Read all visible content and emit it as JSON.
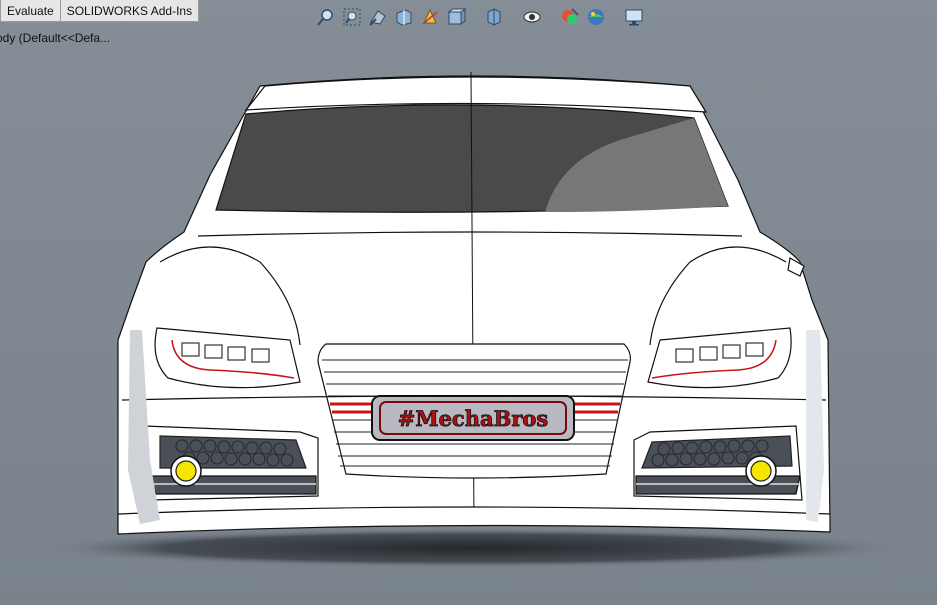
{
  "command_manager": {
    "tabs": [
      {
        "label": "Evaluate"
      },
      {
        "label": "SOLIDWORKS Add-Ins"
      }
    ]
  },
  "feature_tree": {
    "root_label": "ody  (Default<<Defa..."
  },
  "heads_up_toolbar": {
    "icons": [
      "zoom-to-fit-icon",
      "zoom-to-area-icon",
      "previous-view-icon",
      "section-view-icon",
      "dynamic-annotation-icon",
      "view-orientation-icon",
      "display-style-icon",
      "hide-show-items-icon",
      "edit-appearance-icon",
      "apply-scene-icon",
      "view-settings-icon"
    ]
  },
  "model": {
    "plate_text": "#MechaBros",
    "body_color": "#ffffff",
    "window_color": "#4a4a4a",
    "accent_red": "#c81414",
    "fog_light_color": "#f5e600",
    "background_color": "#7e8790"
  }
}
